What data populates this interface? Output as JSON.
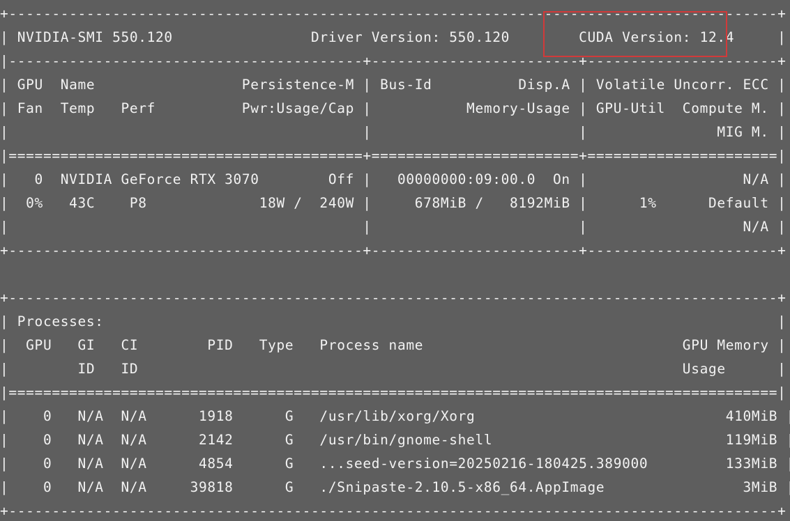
{
  "terminal": {
    "lines": [
      "+-----------------------------------------------------------------------------------------+",
      "| NVIDIA-SMI 550.120                Driver Version: 550.120        CUDA Version: 12.4     |",
      "|-----------------------------------------+------------------------+----------------------+",
      "| GPU  Name                 Persistence-M | Bus-Id          Disp.A | Volatile Uncorr. ECC |",
      "| Fan  Temp   Perf          Pwr:Usage/Cap |           Memory-Usage | GPU-Util  Compute M. |",
      "|                                         |                        |               MIG M. |",
      "|=========================================+========================+======================|",
      "|   0  NVIDIA GeForce RTX 3070        Off |   00000000:09:00.0  On |                  N/A |",
      "|  0%   43C    P8             18W /  240W |     678MiB /   8192MiB |      1%      Default |",
      "|                                         |                        |                  N/A |",
      "+-----------------------------------------+------------------------+----------------------+",
      "",
      "",
      "+-----------------------------------------------------------------------------------------+",
      "| Processes:                                                                              |",
      "|  GPU   GI   CI        PID   Type   Process name                              GPU Memory |",
      "|        ID   ID                                                               Usage      |",
      "|=========================================================================================|",
      "|    0   N/A  N/A      1918      G   /usr/lib/xorg/Xorg                             410MiB |",
      "|    0   N/A  N/A      2142      G   /usr/bin/gnome-shell                           119MiB |",
      "|    0   N/A  N/A      4854      G   ...seed-version=20250216-180425.389000         133MiB |",
      "|    0   N/A  N/A     39818      G   ./Snipaste-2.10.5-x86_64.AppImage                3MiB |",
      "+-----------------------------------------------------------------------------------------+"
    ]
  },
  "colors": {
    "background": "#5e5e5e",
    "text": "#f2f2f2",
    "highlight": "#d23a3a"
  }
}
